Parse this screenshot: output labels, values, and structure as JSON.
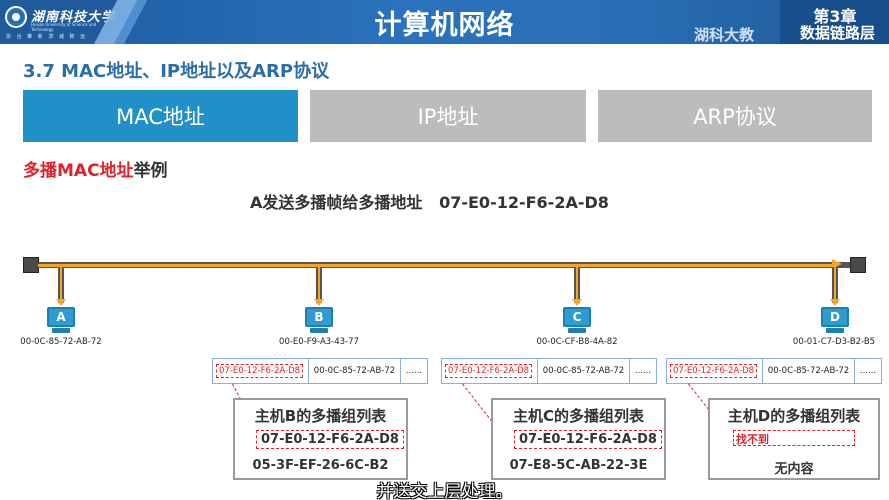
{
  "header": {
    "logo_name": "湖南科技大学",
    "logo_en": "Hunan University of Science and Technology",
    "logo_motto": "协 合 推 新   求 诚 致 远",
    "title": "计算机网络",
    "school": "湖科大教",
    "chapter": "第3章",
    "chapter_sub": "数据链路层"
  },
  "section": {
    "title": "3.7 MAC地址、IP地址以及ARP协议"
  },
  "tabs": [
    {
      "label": "MAC地址",
      "active": true
    },
    {
      "label": "IP地址",
      "active": false
    },
    {
      "label": "ARP协议",
      "active": false
    }
  ],
  "example": {
    "title_red": "多播MAC地址",
    "title_dark": "举例",
    "send_line": "A发送多播帧给多播地址   07-E0-12-F6-2A-D8"
  },
  "hosts": [
    {
      "name": "A",
      "mac": "00-0C-85-72-AB-72"
    },
    {
      "name": "B",
      "mac": "00-E0-F9-A3-43-77"
    },
    {
      "name": "C",
      "mac": "00-0C-CF-B8-4A-82"
    },
    {
      "name": "D",
      "mac": "00-01-C7-D3-B2-B5"
    }
  ],
  "frames": [
    {
      "dst": "07-E0-12-F6-2A-D8",
      "src": "00-0C-85-72-AB-72",
      "more": "......"
    },
    {
      "dst": "07-E0-12-F6-2A-D8",
      "src": "00-0C-85-72-AB-72",
      "more": "......"
    },
    {
      "dst": "07-E0-12-F6-2A-D8",
      "src": "00-0C-85-72-AB-72",
      "more": "......"
    }
  ],
  "groups": [
    {
      "title": "主机B的多播组列表",
      "mac1": "07-E0-12-F6-2A-D8",
      "mac2": "05-3F-EF-26-6C-B2"
    },
    {
      "title": "主机C的多播组列表",
      "mac1": "07-E0-12-F6-2A-D8",
      "mac2": "07-E8-5C-AB-22-3E"
    },
    {
      "title": "主机D的多播组列表",
      "not_found": "找不到",
      "mac2": "无内容"
    }
  ],
  "subtitle": "并送交上层处理。",
  "colors": {
    "accent_blue": "#1f90c8",
    "highlight_red": "#e0222a",
    "signal_orange": "#f4a623"
  }
}
